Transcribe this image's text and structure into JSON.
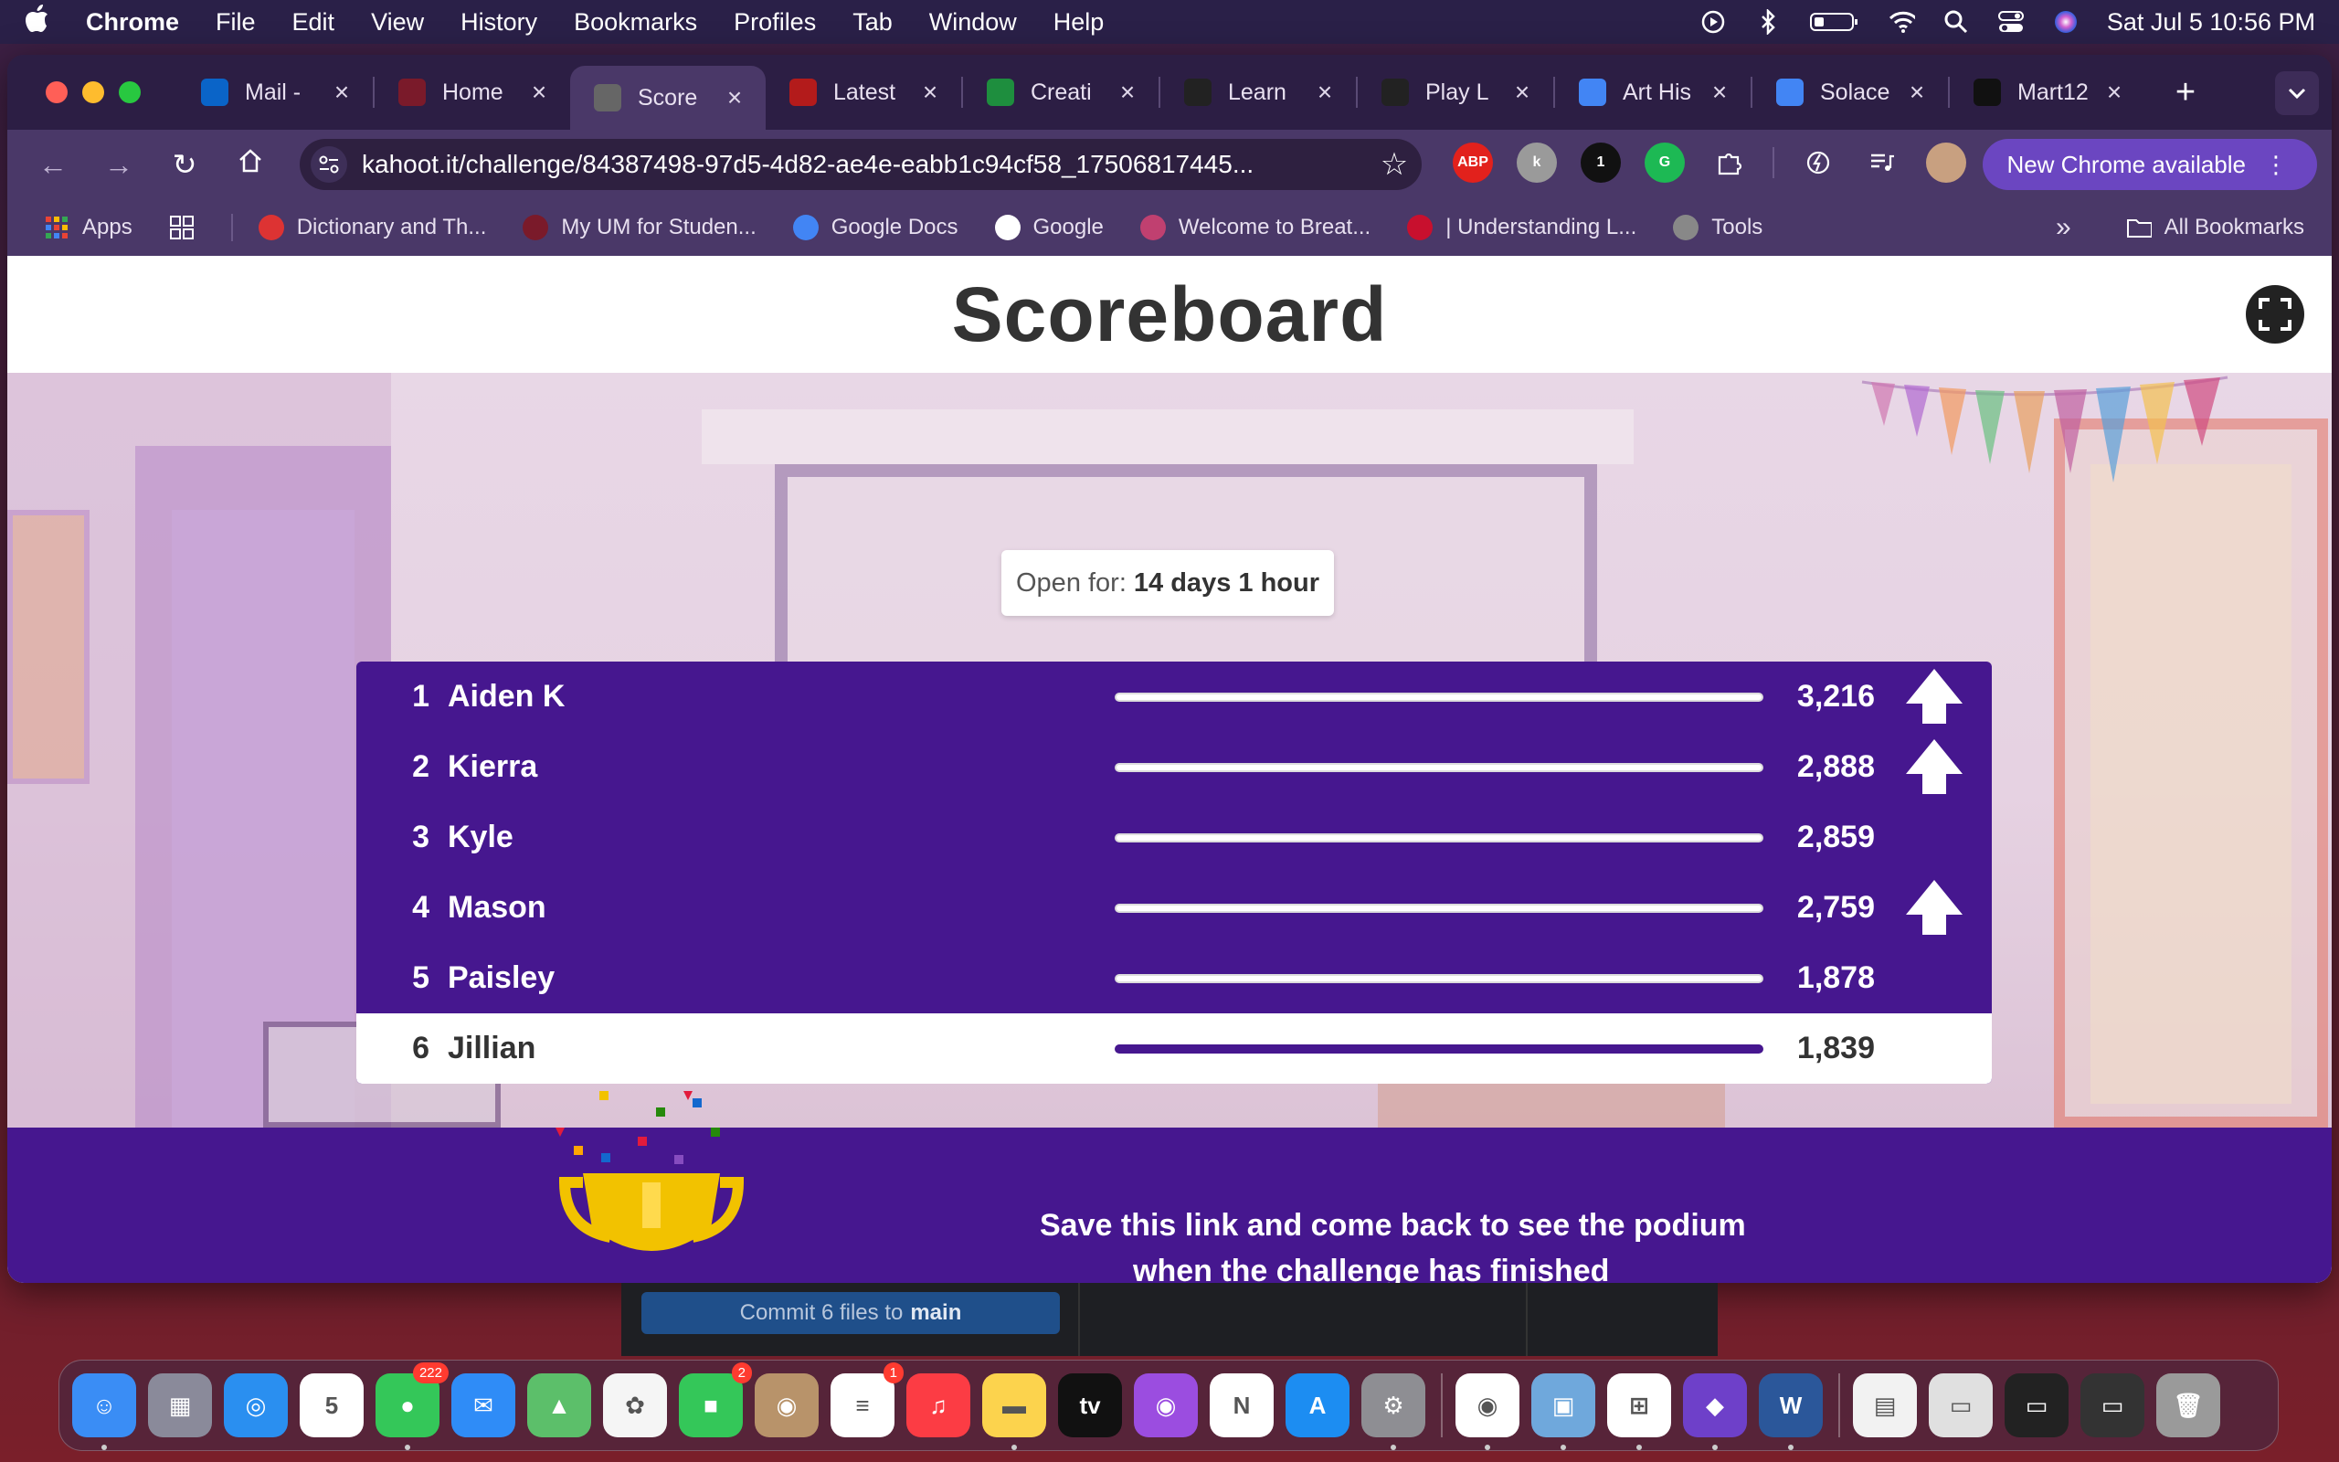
{
  "menubar": {
    "app_name": "Chrome",
    "items": [
      "File",
      "Edit",
      "View",
      "History",
      "Bookmarks",
      "Profiles",
      "Tab",
      "Window",
      "Help"
    ],
    "clock": "Sat Jul 5  10:56 PM"
  },
  "tabs": [
    {
      "label": "Mail -",
      "icon": "outlook-icon",
      "color": "#0a64c8",
      "active": false
    },
    {
      "label": "Home",
      "icon": "umich-icon",
      "color": "#7a1a2a",
      "active": false
    },
    {
      "label": "Score",
      "icon": "globe-icon",
      "color": "#666",
      "active": true
    },
    {
      "label": "Latest",
      "icon": "c-icon",
      "color": "#b31b1b",
      "active": false
    },
    {
      "label": "Creati",
      "icon": "drive-icon",
      "color": "#1e8e3e",
      "active": false
    },
    {
      "label": "Learn",
      "icon": "code-org-icon",
      "color": "#222",
      "active": false
    },
    {
      "label": "Play L",
      "icon": "code-org-icon",
      "color": "#222",
      "active": false
    },
    {
      "label": "Art His",
      "icon": "docs-icon",
      "color": "#4285f4",
      "active": false
    },
    {
      "label": "Solace",
      "icon": "docs-icon",
      "color": "#4285f4",
      "active": false
    },
    {
      "label": "Mart12",
      "icon": "github-icon",
      "color": "#111",
      "active": false
    }
  ],
  "toolbar": {
    "url": "kahoot.it/challenge/84387498-97d5-4d82-ae4e-eabb1c94cf58_17506817445...",
    "new_chrome_label": "New Chrome available",
    "extensions": [
      {
        "label": "ABP",
        "color": "#e2211c"
      },
      {
        "label": "k",
        "color": "#9a9a9a"
      },
      {
        "label": "1",
        "color": "#111"
      },
      {
        "label": "G",
        "color": "#1db954"
      }
    ]
  },
  "bookmarks": {
    "apps_label": "Apps",
    "items": [
      {
        "label": "Dictionary and Th...",
        "icon": "mw-icon",
        "color": "#d33"
      },
      {
        "label": "My UM for Studen...",
        "icon": "umich-icon",
        "color": "#7a1a2a"
      },
      {
        "label": "Google Docs",
        "icon": "docs-icon",
        "color": "#4285f4"
      },
      {
        "label": "Google",
        "icon": "google-icon",
        "color": "#fff"
      },
      {
        "label": "Welcome to Breat...",
        "icon": "breath-icon",
        "color": "#c04070"
      },
      {
        "label": "| Understanding L...",
        "icon": "s-icon",
        "color": "#c8102e"
      },
      {
        "label": "Tools",
        "icon": "globe-icon",
        "color": "#888"
      }
    ],
    "all_bookmarks_label": "All Bookmarks"
  },
  "page": {
    "title": "Scoreboard",
    "open_for_label": "Open for:",
    "open_for_value": "14 days 1 hour",
    "footer_text": "Save this link and come back to see the podium",
    "footer_text2": "when the challenge has finished"
  },
  "leaderboard": [
    {
      "rank": "1",
      "name": "Aiden K",
      "score": "3,216",
      "arrow": true,
      "me": false
    },
    {
      "rank": "2",
      "name": "Kierra",
      "score": "2,888",
      "arrow": true,
      "me": false
    },
    {
      "rank": "3",
      "name": "Kyle",
      "score": "2,859",
      "arrow": false,
      "me": false
    },
    {
      "rank": "4",
      "name": "Mason",
      "score": "2,759",
      "arrow": true,
      "me": false
    },
    {
      "rank": "5",
      "name": "Paisley",
      "score": "1,878",
      "arrow": false,
      "me": false
    },
    {
      "rank": "6",
      "name": "Jillian",
      "score": "1,839",
      "arrow": false,
      "me": true
    }
  ],
  "behind_window": {
    "commit_label": "Commit 6 files to",
    "commit_branch": "main"
  },
  "dock": {
    "apps": [
      {
        "name": "finder-icon",
        "color": "#3a8df5",
        "glyph": "☺",
        "badge": "",
        "dot": true
      },
      {
        "name": "launchpad-icon",
        "color": "#8a8a9a",
        "glyph": "▦",
        "badge": "",
        "dot": false
      },
      {
        "name": "safari-icon",
        "color": "#2a8ff0",
        "glyph": "◎",
        "badge": "",
        "dot": false
      },
      {
        "name": "calendar-icon",
        "color": "#ffffff",
        "glyph": "5",
        "badge": "",
        "dot": false
      },
      {
        "name": "messages-icon",
        "color": "#34c759",
        "glyph": "●",
        "badge": "222",
        "dot": true
      },
      {
        "name": "mail-icon",
        "color": "#2f8cf7",
        "glyph": "✉",
        "badge": "",
        "dot": false
      },
      {
        "name": "maps-icon",
        "color": "#5cbf6a",
        "glyph": "▲",
        "badge": "",
        "dot": false
      },
      {
        "name": "photos-icon",
        "color": "#f5f5f5",
        "glyph": "✿",
        "badge": "",
        "dot": false
      },
      {
        "name": "facetime-icon",
        "color": "#34c759",
        "glyph": "■",
        "badge": "2",
        "dot": false
      },
      {
        "name": "contacts-icon",
        "color": "#b8936a",
        "glyph": "◉",
        "badge": "",
        "dot": false
      },
      {
        "name": "reminders-icon",
        "color": "#ffffff",
        "glyph": "≡",
        "badge": "1",
        "dot": false
      },
      {
        "name": "music-icon",
        "color": "#fc3c44",
        "glyph": "♫",
        "badge": "",
        "dot": false
      },
      {
        "name": "notes-icon",
        "color": "#fcd34d",
        "glyph": "▬",
        "badge": "",
        "dot": true
      },
      {
        "name": "tv-icon",
        "color": "#111111",
        "glyph": "tv",
        "badge": "",
        "dot": false
      },
      {
        "name": "podcasts-icon",
        "color": "#9b4de0",
        "glyph": "◉",
        "badge": "",
        "dot": false
      },
      {
        "name": "news-icon",
        "color": "#ffffff",
        "glyph": "N",
        "badge": "",
        "dot": false
      },
      {
        "name": "app-store-icon",
        "color": "#1c8df2",
        "glyph": "A",
        "badge": "",
        "dot": false
      },
      {
        "name": "system-settings-icon",
        "color": "#8e8e93",
        "glyph": "⚙",
        "badge": "",
        "dot": true
      },
      {
        "name": "chrome-icon",
        "color": "#ffffff",
        "glyph": "◉",
        "badge": "",
        "dot": true
      },
      {
        "name": "preview-icon",
        "color": "#6fa8dc",
        "glyph": "▣",
        "badge": "",
        "dot": true
      },
      {
        "name": "office-installer-icon",
        "color": "#ffffff",
        "glyph": "⊞",
        "badge": "",
        "dot": true
      },
      {
        "name": "github-desktop-icon",
        "color": "#6e40c9",
        "glyph": "◆",
        "badge": "",
        "dot": true
      },
      {
        "name": "word-icon",
        "color": "#2b579a",
        "glyph": "W",
        "badge": "",
        "dot": true
      },
      {
        "name": "document-icon",
        "color": "#f2f2f2",
        "glyph": "▤",
        "badge": "",
        "dot": false
      },
      {
        "name": "screenshot-thumb-icon",
        "color": "#e0e0e0",
        "glyph": "▭",
        "badge": "",
        "dot": false
      },
      {
        "name": "window-thumb-icon",
        "color": "#222222",
        "glyph": "▭",
        "badge": "",
        "dot": false
      },
      {
        "name": "terminal-thumb-icon",
        "color": "#333333",
        "glyph": "▭",
        "badge": "",
        "dot": false
      },
      {
        "name": "trash-icon",
        "color": "#9a9a9a",
        "glyph": "🗑",
        "badge": "",
        "dot": false
      }
    ]
  }
}
